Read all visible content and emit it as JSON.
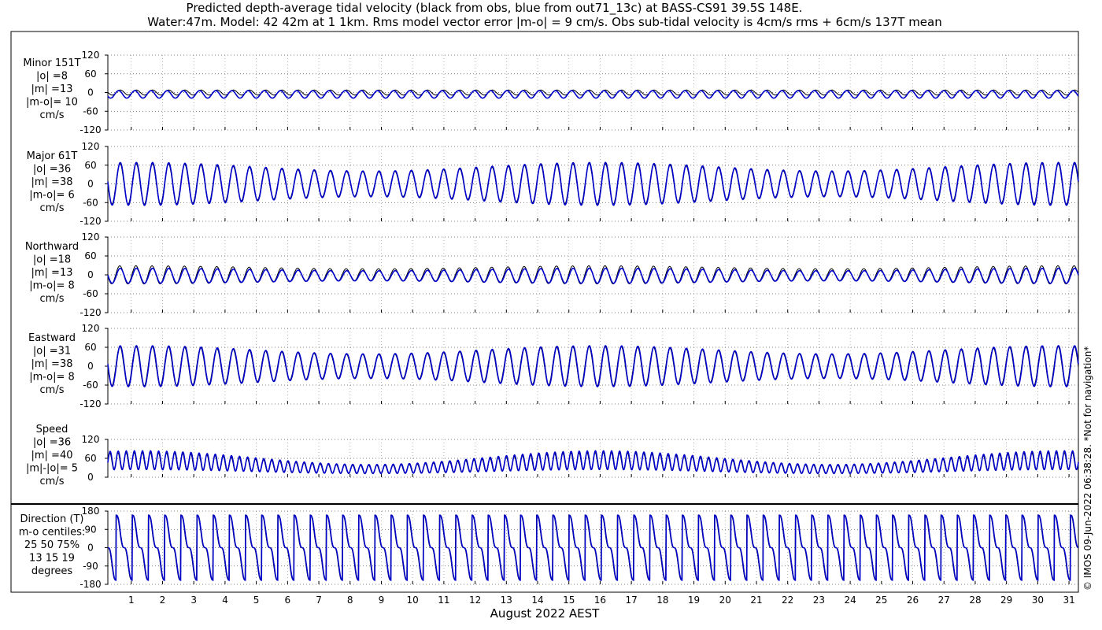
{
  "title_line1": "Predicted depth-average tidal velocity (black from obs, blue from out71_13c) at BASS-CS91 39.5S 148E.",
  "title_line2": "Water:47m. Model: 42 42m at 1 1km. Rms model vector error |m-o| = 9 cm/s. Obs sub-tidal velocity is 4cm/s rms + 6cm/s 137T mean",
  "xlabel": "August 2022 AEST",
  "watermark": "© IMOS 09-Jun-2022 06:38:28. *Not for navigation*",
  "colors": {
    "obs": "#000000",
    "model": "#0000cc"
  },
  "chart_data": [
    {
      "type": "line",
      "name": "minor",
      "label_lines": [
        "Minor 151T",
        "|o| =8",
        "|m| =13",
        "|m-o|= 10",
        "cm/s"
      ],
      "ylim": [
        -120,
        120
      ],
      "yticks": [
        "120",
        "60",
        "0",
        "-60",
        "-120"
      ],
      "ytick_values": [
        120,
        60,
        0,
        -60,
        -120
      ],
      "xlim": [
        0.25,
        31.3
      ],
      "xticks": [
        "1",
        "2",
        "3",
        "4",
        "5",
        "6",
        "7",
        "8",
        "9",
        "10",
        "11",
        "12",
        "13",
        "14",
        "15",
        "16",
        "17",
        "18",
        "19",
        "20",
        "21",
        "22",
        "23",
        "24",
        "25",
        "26",
        "27",
        "28",
        "29",
        "30",
        "31"
      ],
      "grid": true,
      "series": [
        {
          "role": "obs",
          "signal": "oscillation",
          "amplitude": 8,
          "offset": 0,
          "period_days": 0.5175,
          "phase": 0
        },
        {
          "role": "model",
          "signal": "oscillation",
          "amplitude": 12,
          "offset": -6,
          "period_days": 0.5175,
          "phase": 0.6
        }
      ]
    },
    {
      "type": "line",
      "name": "major",
      "label_lines": [
        "Major 61T",
        "|o| =36",
        "|m| =38",
        "|m-o|= 6",
        "cm/s"
      ],
      "ylim": [
        -120,
        120
      ],
      "yticks": [
        "120",
        "60",
        "0",
        "-60",
        "-120"
      ],
      "ytick_values": [
        120,
        60,
        0,
        -60,
        -120
      ],
      "xlim": [
        0.25,
        31.3
      ],
      "grid": true,
      "series": [
        {
          "role": "obs",
          "signal": "oscillation",
          "amplitude": 52,
          "offset": 0,
          "period_days": 0.5175,
          "phase": 0.1,
          "spring_neap": 0.25
        },
        {
          "role": "model",
          "signal": "oscillation",
          "amplitude": 55,
          "offset": 0,
          "period_days": 0.5175,
          "phase": 0,
          "spring_neap": 0.25
        }
      ]
    },
    {
      "type": "line",
      "name": "northward",
      "label_lines": [
        "Northward",
        "|o| =18",
        "|m| =13",
        "|m-o|= 8",
        "cm/s"
      ],
      "ylim": [
        -120,
        120
      ],
      "yticks": [
        "120",
        "60",
        "0",
        "-60",
        "-120"
      ],
      "ytick_values": [
        120,
        60,
        0,
        -60,
        -120
      ],
      "xlim": [
        0.25,
        31.3
      ],
      "grid": true,
      "series": [
        {
          "role": "obs",
          "signal": "oscillation",
          "amplitude": 24,
          "offset": 0,
          "period_days": 0.5175,
          "phase": 0.2,
          "spring_neap": 0.2
        },
        {
          "role": "model",
          "signal": "oscillation",
          "amplitude": 20,
          "offset": -3,
          "period_days": 0.5175,
          "phase": 0,
          "spring_neap": 0.2
        }
      ]
    },
    {
      "type": "line",
      "name": "eastward",
      "label_lines": [
        "Eastward",
        "|o| =31",
        "|m| =38",
        "|m-o|= 8",
        "cm/s"
      ],
      "ylim": [
        -120,
        120
      ],
      "yticks": [
        "120",
        "60",
        "0",
        "-60",
        "-120"
      ],
      "ytick_values": [
        120,
        60,
        0,
        -60,
        -120
      ],
      "xlim": [
        0.25,
        31.3
      ],
      "grid": true,
      "series": [
        {
          "role": "obs",
          "signal": "oscillation",
          "amplitude": 50,
          "offset": 0,
          "period_days": 0.5175,
          "phase": 0.15,
          "spring_neap": 0.25
        },
        {
          "role": "model",
          "signal": "oscillation",
          "amplitude": 52,
          "offset": 0,
          "period_days": 0.5175,
          "phase": 0,
          "spring_neap": 0.25
        }
      ]
    },
    {
      "type": "line",
      "name": "speed",
      "label_lines": [
        "Speed",
        "|o| =36",
        "|m| =40",
        "|m|-|o|= 5",
        "cm/s"
      ],
      "ylim": [
        0,
        120
      ],
      "yticks": [
        "120",
        "60",
        "0"
      ],
      "ytick_values": [
        120,
        60,
        0
      ],
      "xlim": [
        0.25,
        31.3
      ],
      "grid": true,
      "series": [
        {
          "role": "obs",
          "signal": "speed",
          "amplitude": 20,
          "offset": 38,
          "period_days": 0.25875,
          "phase": 0.2,
          "spring_neap": 0.35
        },
        {
          "role": "model",
          "signal": "speed",
          "amplitude": 22,
          "offset": 40,
          "period_days": 0.25875,
          "phase": 0,
          "spring_neap": 0.35
        }
      ]
    },
    {
      "type": "line",
      "name": "direction",
      "label_lines": [
        "Direction (T)",
        "m-o centiles:",
        "25  50  75%",
        "13  15  19",
        "degrees"
      ],
      "ylim": [
        -180,
        180
      ],
      "yticks": [
        "180",
        "90",
        "0",
        "-90",
        "-180"
      ],
      "ytick_values": [
        180,
        90,
        0,
        -90,
        -180
      ],
      "xlim": [
        0.25,
        31.3
      ],
      "grid": true,
      "series": [
        {
          "role": "obs",
          "signal": "direction",
          "period_days": 0.5175,
          "phase": 0.15
        },
        {
          "role": "model",
          "signal": "direction",
          "period_days": 0.5175,
          "phase": 0
        }
      ]
    }
  ]
}
